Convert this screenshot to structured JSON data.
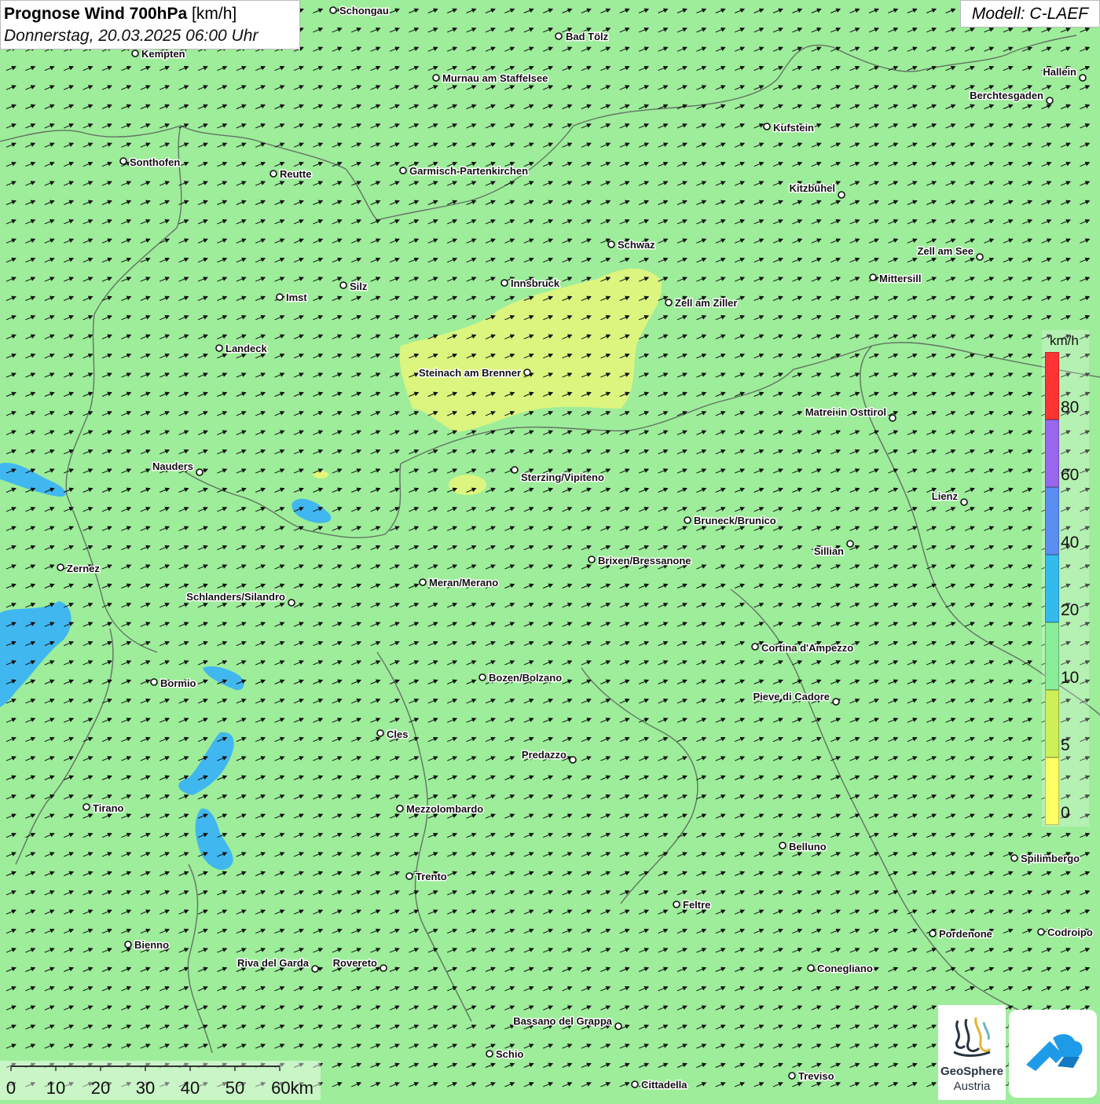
{
  "title": {
    "product_bold": "Prognose Wind 700hPa",
    "unit": "[km/h]",
    "datetime": "Donnerstag, 20.03.2025 06:00 Uhr"
  },
  "model": "Modell: C-LAEF",
  "legend": {
    "unit": "km/h",
    "ticks": [
      "80",
      "60",
      "40",
      "20",
      "10",
      "5",
      "0"
    ],
    "colors": [
      "#ff3333",
      "#9966ee",
      "#5b8df0",
      "#33bbee",
      "#88ee99",
      "#ccf055",
      "#ffff66"
    ]
  },
  "scale": {
    "labels": [
      "0",
      "10",
      "20",
      "30",
      "40",
      "50",
      "60km"
    ]
  },
  "colors": {
    "background": "#9ded9a",
    "yellow_area": "#e3f57c",
    "blue_area": "#41b7f0",
    "border": "#555555",
    "arrow": "#111111"
  },
  "wind": {
    "direction": "east-north-east"
  },
  "logos": {
    "geosphere_line1": "GeoSphere",
    "geosphere_line2": "Austria"
  },
  "cities": [
    {
      "name": "Schongau"
    },
    {
      "name": "Bad Tölz"
    },
    {
      "name": "Kempten"
    },
    {
      "name": "Murnau am Staffelsee"
    },
    {
      "name": "Hallein"
    },
    {
      "name": "Berchtesgaden"
    },
    {
      "name": "Kufstein"
    },
    {
      "name": "Sonthofen"
    },
    {
      "name": "Reutte"
    },
    {
      "name": "Garmisch-Partenkirchen"
    },
    {
      "name": "Kitzbühel"
    },
    {
      "name": "Schwaz"
    },
    {
      "name": "Zell am See"
    },
    {
      "name": "Innsbruck"
    },
    {
      "name": "Mittersill"
    },
    {
      "name": "Imst"
    },
    {
      "name": "Silz"
    },
    {
      "name": "Zell am Ziller"
    },
    {
      "name": "Landeck"
    },
    {
      "name": "Steinach am Brenner"
    },
    {
      "name": "Matrei in Osttirol"
    },
    {
      "name": "Nauders"
    },
    {
      "name": "Sterzing/Vipiteno"
    },
    {
      "name": "Lienz"
    },
    {
      "name": "Bruneck/Brunico"
    },
    {
      "name": "Sillian"
    },
    {
      "name": "Zernez"
    },
    {
      "name": "Brixen/Bressanone"
    },
    {
      "name": "Meran/Merano"
    },
    {
      "name": "Schlanders/Silandro"
    },
    {
      "name": "Cortina d'Ampezzo"
    },
    {
      "name": "Bormio"
    },
    {
      "name": "Bozen/Bolzano"
    },
    {
      "name": "Pieve di Cadore"
    },
    {
      "name": "Cles"
    },
    {
      "name": "Predazzo"
    },
    {
      "name": "Tirano"
    },
    {
      "name": "Mezzolombardo"
    },
    {
      "name": "Belluno"
    },
    {
      "name": "Spilimbergo"
    },
    {
      "name": "Trento"
    },
    {
      "name": "Feltre"
    },
    {
      "name": "Pordenone"
    },
    {
      "name": "Codroipo"
    },
    {
      "name": "Bienno"
    },
    {
      "name": "Riva del Garda"
    },
    {
      "name": "Rovereto"
    },
    {
      "name": "Conegliano"
    },
    {
      "name": "Bassano del Grappa"
    },
    {
      "name": "Schio"
    },
    {
      "name": "Treviso"
    },
    {
      "name": "Cittadella"
    }
  ]
}
